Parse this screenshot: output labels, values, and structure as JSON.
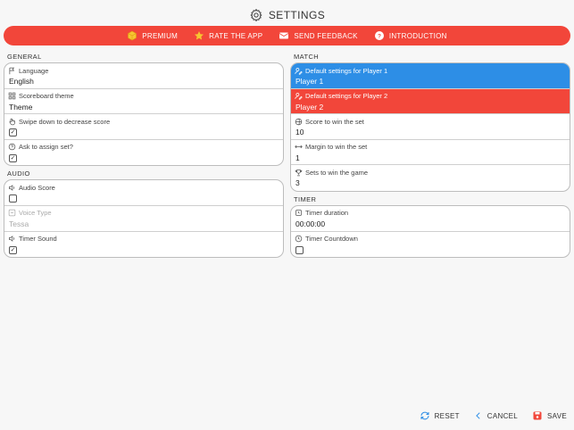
{
  "header": {
    "title": "SETTINGS"
  },
  "banner": {
    "items": [
      {
        "label": "PREMIUM",
        "icon": "cube-icon"
      },
      {
        "label": "RATE THE APP",
        "icon": "star-icon"
      },
      {
        "label": "SEND FEEDBACK",
        "icon": "mail-icon"
      },
      {
        "label": "INTRODUCTION",
        "icon": "question-icon"
      }
    ]
  },
  "general": {
    "title": "GENERAL",
    "language": {
      "label": "Language",
      "value": "English"
    },
    "scoreboard_theme": {
      "label": "Scoreboard theme",
      "value": "Theme"
    },
    "swipe_down": {
      "label": "Swipe down to decrease score",
      "checked": true
    },
    "ask_assign": {
      "label": "Ask to assign set?",
      "checked": true
    }
  },
  "audio": {
    "title": "AUDIO",
    "audio_score": {
      "label": "Audio Score",
      "checked": false
    },
    "voice_type": {
      "label": "Voice Type",
      "value": "Tessa"
    },
    "timer_sound": {
      "label": "Timer Sound",
      "checked": true
    }
  },
  "match": {
    "title": "MATCH",
    "player1": {
      "label": "Default settings for Player 1",
      "value": "Player 1",
      "color": "#2d8ee6"
    },
    "player2": {
      "label": "Default settings for Player 2",
      "value": "Player 2",
      "color": "#f2463a"
    },
    "score_to_win": {
      "label": "Score to win the set",
      "value": "10"
    },
    "margin": {
      "label": "Margin to win the set",
      "value": "1"
    },
    "sets_to_win": {
      "label": "Sets to win the game",
      "value": "3"
    }
  },
  "timer": {
    "title": "TIMER",
    "duration": {
      "label": "Timer duration",
      "value": "00:00:00"
    },
    "countdown": {
      "label": "Timer Countdown",
      "checked": false
    }
  },
  "footer": {
    "reset": "RESET",
    "cancel": "CANCEL",
    "save": "SAVE"
  },
  "colors": {
    "accent_red": "#f2463a",
    "accent_blue": "#2d8ee6",
    "background": "#f7f7f7"
  }
}
